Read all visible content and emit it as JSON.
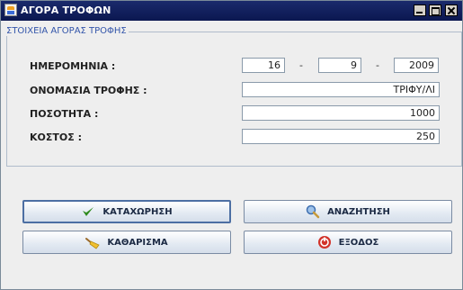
{
  "window": {
    "title": "ΑΓΟΡΑ ΤΡΟΦΩΝ"
  },
  "group": {
    "legend": "ΣΤΟΙΧΕΙΑ ΑΓΟΡΑΣ ΤΡΟΦΗΣ"
  },
  "form": {
    "date_label": "ΗΜΕΡΟΜΗΝΙΑ :",
    "day": "16",
    "month": "9",
    "year": "2009",
    "separator": "-",
    "food_name_label": "ΟΝΟΜΑΣΙΑ ΤΡΟΦΗΣ :",
    "food_name": "ΤΡΙΦΥ/ΛΙ",
    "quantity_label": "ΠΟΣΟΤΗΤΑ :",
    "quantity": "1000",
    "cost_label": "ΚΟΣΤΟΣ :",
    "cost": "250"
  },
  "buttons": {
    "save": "ΚΑΤΑΧΩΡΗΣΗ",
    "search": "ΑΝΑΖΗΤΗΣΗ",
    "clear": "ΚΑΘΑΡΙΣΜΑ",
    "exit": "ΕΞΟΔΟΣ"
  },
  "icons": {
    "save": "checkmark-icon",
    "search": "magnifier-icon",
    "clear": "broom-icon",
    "exit": "exit-icon",
    "app": "java-icon"
  },
  "colors": {
    "titlebar": "#0b1750",
    "legend": "#3355aa",
    "check": "#2f8a1e",
    "exit": "#d2332a"
  }
}
